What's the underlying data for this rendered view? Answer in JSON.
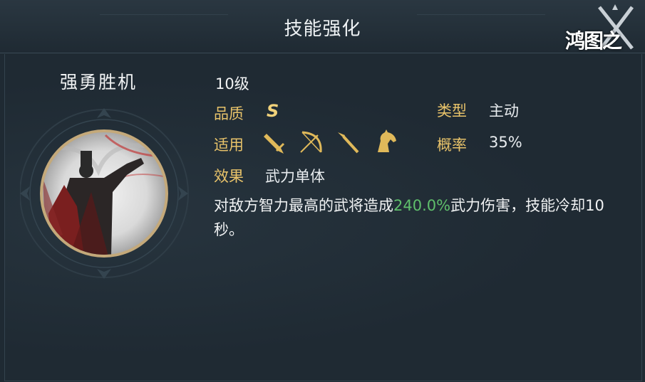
{
  "header": {
    "title": "技能强化"
  },
  "logo": {
    "text": "鸿图之下"
  },
  "skill": {
    "name": "强勇胜机",
    "level": "10级",
    "quality_label": "品质",
    "quality_value": "S",
    "type_label": "类型",
    "type_value": "主动",
    "applicable_label": "适用",
    "applicable_icons": [
      "sword-icon",
      "bow-icon",
      "spear-icon",
      "horse-icon"
    ],
    "probability_label": "概率",
    "probability_value": "35%",
    "effect_label": "效果",
    "effect_value": "武力单体",
    "desc_prefix": "对敌方智力最高的武将造成",
    "desc_highlight": "240.0%",
    "desc_suffix": "武力伤害，技能冷却10秒。"
  },
  "colors": {
    "label": "#e8c36a",
    "highlight": "#5fbf6b",
    "quality": "#f1d27a"
  }
}
